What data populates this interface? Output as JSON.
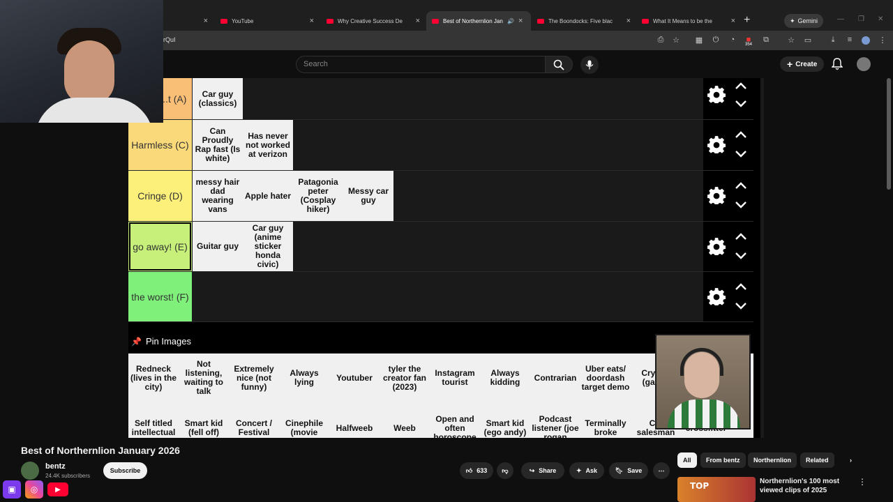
{
  "browser": {
    "tabs": [
      {
        "label": "",
        "active": false
      },
      {
        "label": "YouTube",
        "active": false
      },
      {
        "label": "Why Creative Success De",
        "active": false
      },
      {
        "label": "Best of Northernlion Jan",
        "active": true
      },
      {
        "label": "The Boondocks: Five blac",
        "active": false
      },
      {
        "label": "What It Means to be the",
        "active": false
      }
    ],
    "gemini_label": "Gemini",
    "url_fragment": "rQuI",
    "extension_badge": "354"
  },
  "youtube": {
    "search_placeholder": "Search",
    "create_label": "Create"
  },
  "tier_list": {
    "tiers": [
      {
        "label": "...y're ...t (A)",
        "color": "#f9bf76",
        "items": [
          "Car guy (classics)"
        ]
      },
      {
        "label": "Harmless (C)",
        "color": "#f9d97a",
        "items": [
          "Can Proudly Rap fast (Is white)",
          "Has never not worked at verizon"
        ]
      },
      {
        "label": "Cringe (D)",
        "color": "#fcf07b",
        "items": [
          "messy hair dad wearing vans",
          "Apple hater",
          "Patagonia peter (Cosplay hiker)",
          "Messy car guy"
        ]
      },
      {
        "label": "go away! (E)",
        "color": "#c6f07a",
        "items": [
          "Guitar guy",
          "Car guy (anime sticker honda civic)"
        ]
      },
      {
        "label": "the worst! (F)",
        "color": "#7ff07a",
        "items": []
      }
    ],
    "pin_label": "Pin Images",
    "pin_items_row1": [
      "Redneck (lives in the city)",
      "Not listening, waiting to talk",
      "Extremely nice (not funny)",
      "Always lying",
      "Youtuber",
      "tyler the creator fan (2023)",
      "Instagram tourist",
      "Always kidding",
      "Contrarian",
      "Uber eats/ doordash target demo",
      "Crypt... (gam..."
    ],
    "pin_items_row2": [
      "Self titled intellectual",
      "Smart kid (fell off)",
      "Concert / Festival",
      "Cinephile (movie",
      "Halfweeb",
      "Weeb",
      "Open and often horoscope",
      "Smart kid (ego andy)",
      "Podcast listener (joe rogan",
      "Terminally broke",
      "C... salesman",
      "crossfitter"
    ]
  },
  "video": {
    "title": "Best of Northernlion January 2026",
    "channel": "bentz",
    "subscribers": "24.4K subscribers",
    "subscribe_label": "Subscribe",
    "likes": "633",
    "share_label": "Share",
    "ask_label": "Ask",
    "save_label": "Save"
  },
  "sidebar": {
    "filters": [
      "All",
      "From bentz",
      "Northernlion",
      "Related"
    ],
    "recommended": {
      "thumb_text": "TOP",
      "title": "Northernlion's 100 most viewed clips of 2025"
    }
  },
  "colors": {
    "accent": "#ff0033"
  }
}
